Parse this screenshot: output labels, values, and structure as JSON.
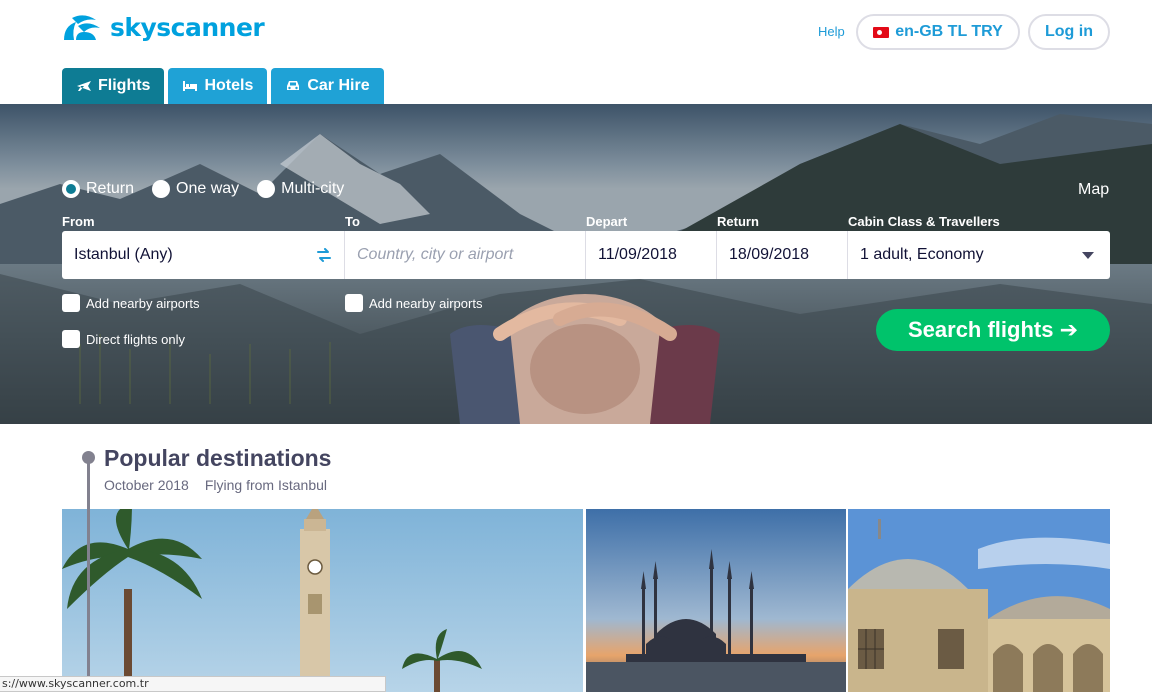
{
  "brand": {
    "name": "skyscanner",
    "color": "#00a1de"
  },
  "header": {
    "help_label": "Help",
    "locale_label": "en-GB TL TRY",
    "locale_flag": "turkey-flag",
    "login_label": "Log in"
  },
  "tabs": [
    {
      "label": "Flights",
      "icon": "plane-icon",
      "active": true
    },
    {
      "label": "Hotels",
      "icon": "bed-icon",
      "active": false
    },
    {
      "label": "Car Hire",
      "icon": "car-icon",
      "active": false
    }
  ],
  "search": {
    "trip_types": [
      {
        "label": "Return",
        "checked": true
      },
      {
        "label": "One way",
        "checked": false
      },
      {
        "label": "Multi-city",
        "checked": false
      }
    ],
    "map_label": "Map",
    "labels": {
      "from": "From",
      "to": "To",
      "depart": "Depart",
      "return": "Return",
      "cabin": "Cabin Class & Travellers"
    },
    "from_value": "Istanbul (Any)",
    "to_placeholder": "Country, city or airport",
    "depart_value": "11/09/2018",
    "return_value": "18/09/2018",
    "cabin_value": "1 adult, Economy",
    "nearby_from_label": "Add nearby airports",
    "nearby_to_label": "Add nearby airports",
    "direct_label": "Direct flights only",
    "search_button_label": "Search flights ➔",
    "search_button_color": "#00c36b"
  },
  "popular": {
    "title": "Popular destinations",
    "month": "October 2018",
    "from": "Flying from Istanbul"
  },
  "status_bar": {
    "url": "s://www.skyscanner.com.tr"
  },
  "colors": {
    "accent": "#1e9bd7",
    "tab_active": "#0e7c94",
    "tab": "#1fa2d6"
  }
}
